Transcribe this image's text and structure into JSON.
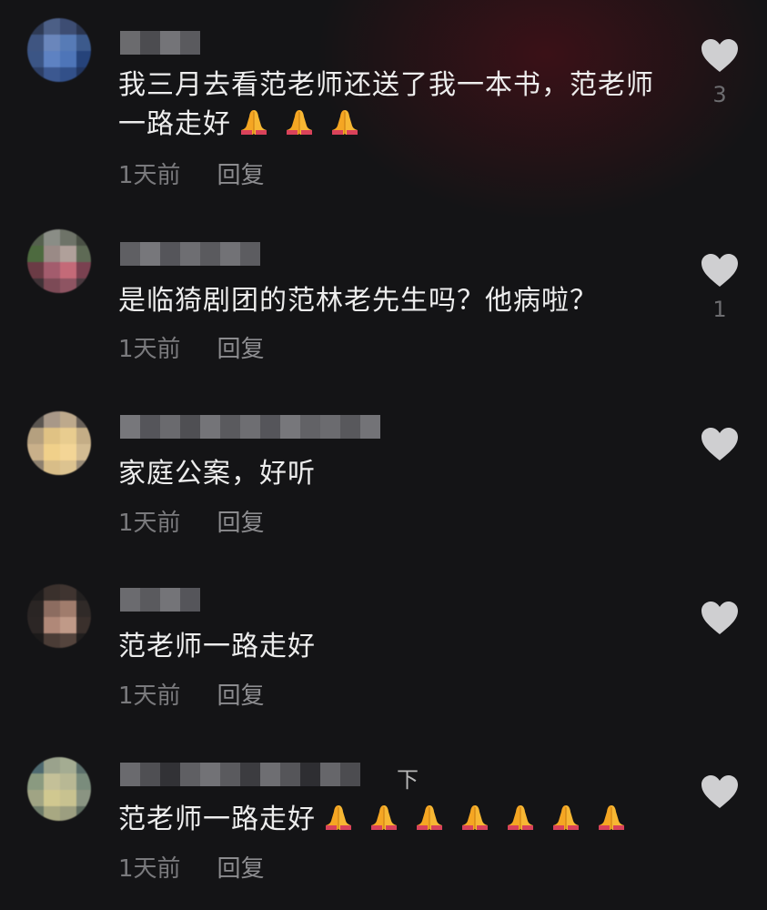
{
  "comments": [
    {
      "text": "我三月去看范老师还送了我一本书，范老师一路走好",
      "emoji_count": 3,
      "time": "1天前",
      "reply": "回复",
      "likes": "3"
    },
    {
      "text": "是临猗剧团的范林老先生吗？他病啦？",
      "emoji_count": 0,
      "time": "1天前",
      "reply": "回复",
      "likes": "1"
    },
    {
      "text": "家庭公案，好听",
      "emoji_count": 0,
      "time": "1天前",
      "reply": "回复",
      "likes": ""
    },
    {
      "text": "范老师一路走好",
      "emoji_count": 0,
      "time": "1天前",
      "reply": "回复",
      "likes": ""
    },
    {
      "text": "范老师一路走好",
      "emoji_count": 7,
      "time": "1天前",
      "reply": "回复",
      "likes": ""
    }
  ],
  "username_suffix": "下",
  "icons": {
    "like": "heart-icon",
    "emoji": "folded-hands-emoji"
  },
  "colors": {
    "background": "#141416",
    "text": "#ededed",
    "meta": "#7a7a7d",
    "heart": "#cfcfd1"
  }
}
